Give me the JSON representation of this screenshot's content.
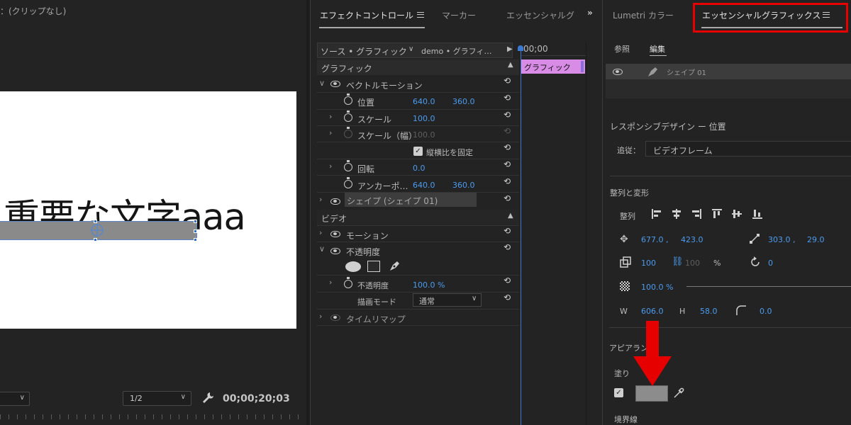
{
  "program": {
    "title": "：(クリップなし)",
    "canvas_text": "重要な文字aaa",
    "zoom": "1/2",
    "timecode": "00;00;20;03"
  },
  "effect_controls": {
    "tabs": [
      "エフェクトコントロール",
      "マーカー",
      "エッセンシャルグ"
    ],
    "source_label": "ソース • グラフィック",
    "sequence_label": "demo • グラフィ…",
    "timecode": "00;00",
    "clip_label": "グラフィック",
    "sections": {
      "graphic": "グラフィック",
      "video": "ビデオ"
    },
    "vector_motion": "ベクトルモーション",
    "position": {
      "label": "位置",
      "x": "640.0",
      "y": "360.0"
    },
    "scale": {
      "label": "スケール",
      "value": "100.0"
    },
    "scale_width": {
      "label": "スケール（幅）",
      "value": "100.0"
    },
    "lock_ratio": "縦横比を固定",
    "rotation": {
      "label": "回転",
      "value": "0.0"
    },
    "anchor": {
      "label": "アンカーポ…",
      "x": "640.0",
      "y": "360.0"
    },
    "shape_layer": "シェイプ (シェイプ 01)",
    "motion": "モーション",
    "opacity_group": "不透明度",
    "opacity": {
      "label": "不透明度",
      "value": "100.0 %"
    },
    "blend": {
      "label": "描画モード",
      "value": "通常"
    },
    "time_remap": "タイムリマップ"
  },
  "essential_graphics": {
    "tabs": [
      "Lumetri カラー",
      "エッセンシャルグラフィックス"
    ],
    "subtabs": [
      "参照",
      "編集"
    ],
    "layer_name": "シェイプ 01",
    "responsive_title": "レスポンシブデザイン ー 位置",
    "follow_label": "追従：",
    "follow_value": "ビデオフレーム",
    "align_title": "整列と変形",
    "align_label": "整列",
    "pos_x": "677.0 ,",
    "pos_y": "423.0",
    "anchor_x": "303.0 ,",
    "anchor_y": "29.0",
    "scale_value": "100",
    "scale_locked_value": "100",
    "scale_unit": "%",
    "rotation_value": "0",
    "opacity_value": "100.0 %",
    "w_label": "W",
    "w_value": "606.0",
    "h_label": "H",
    "h_value": "58.0",
    "radius_value": "0.0",
    "appearance_title": "アピアランス",
    "fill_label": "塗り",
    "stroke_label": "境界線"
  },
  "colors": {
    "accent": "#4b9cf0",
    "highlight": "#e60000",
    "clip": "#d88ce6"
  }
}
